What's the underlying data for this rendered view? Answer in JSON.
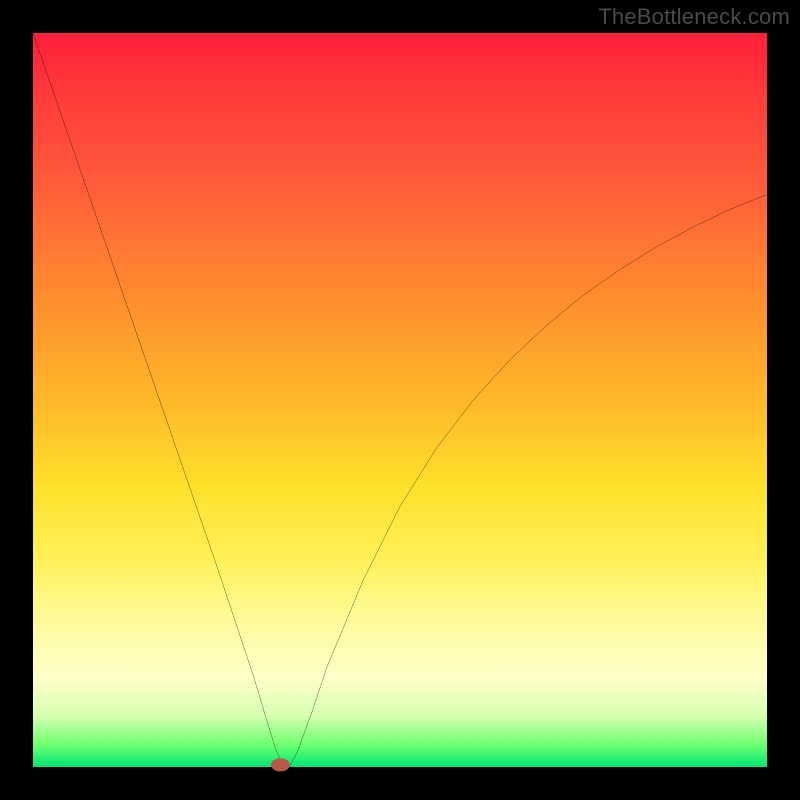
{
  "watermark": "TheBottleneck.com",
  "chart_data": {
    "type": "line",
    "title": "",
    "xlabel": "",
    "ylabel": "",
    "xlim": [
      0,
      100
    ],
    "ylim": [
      0,
      100
    ],
    "grid": false,
    "series": [
      {
        "name": "curve",
        "x": [
          0,
          5,
          10,
          15,
          20,
          25,
          28,
          30,
          31.5,
          33,
          34,
          35,
          36,
          38,
          40,
          45,
          50,
          55,
          60,
          65,
          70,
          75,
          80,
          85,
          90,
          95,
          100
        ],
        "values": [
          100,
          85.5,
          71,
          56.5,
          42,
          27.5,
          18.5,
          12.5,
          7.5,
          2.6,
          0.2,
          0.2,
          2.0,
          7.5,
          13.5,
          25.5,
          35.5,
          43.5,
          50.0,
          55.5,
          60.2,
          64.3,
          67.8,
          70.9,
          73.6,
          76.0,
          78.0
        ]
      }
    ],
    "marker": {
      "x": 33.7,
      "y": 0.3,
      "rx": 1.3,
      "ry": 0.9
    },
    "note": "x/y are percents of the plot area; y=0 at bottom, y=100 at top."
  },
  "colors": {
    "curve": "#000000",
    "marker": "#b85a4a",
    "frame": "#000000"
  }
}
